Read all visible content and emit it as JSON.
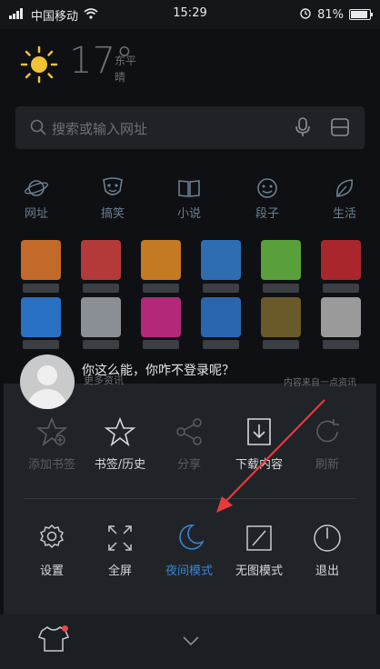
{
  "status": {
    "carrier": "中国移动",
    "time": "15:29",
    "battery": "81%"
  },
  "weather": {
    "temp": "17°",
    "city": "东平",
    "condition": "晴"
  },
  "search": {
    "placeholder": "搜索或输入网址"
  },
  "categories": [
    {
      "label": "网址",
      "icon": "planet-icon"
    },
    {
      "label": "搞笑",
      "icon": "mask-icon"
    },
    {
      "label": "小说",
      "icon": "book-icon"
    },
    {
      "label": "段子",
      "icon": "smile-icon"
    },
    {
      "label": "生活",
      "icon": "leaf-icon"
    }
  ],
  "user": {
    "greeting": "你这么能，你咋不登录呢？",
    "faded_left": "更多资讯",
    "faded_right": "内容来自一点资讯"
  },
  "menu_row1": [
    {
      "label": "添加书签",
      "icon": "star-plus-icon",
      "state": "dim"
    },
    {
      "label": "书签/历史",
      "icon": "star-icon",
      "state": "bright"
    },
    {
      "label": "分享",
      "icon": "share-icon",
      "state": "dim"
    },
    {
      "label": "下载内容",
      "icon": "download-icon",
      "state": "bright"
    },
    {
      "label": "刷新",
      "icon": "refresh-icon",
      "state": "dim"
    }
  ],
  "menu_row2": [
    {
      "label": "设置",
      "icon": "gear-icon",
      "state": "normal"
    },
    {
      "label": "全屏",
      "icon": "fullscreen-icon",
      "state": "normal"
    },
    {
      "label": "夜间模式",
      "icon": "moon-icon",
      "state": "active"
    },
    {
      "label": "无图模式",
      "icon": "no-image-icon",
      "state": "normal"
    },
    {
      "label": "退出",
      "icon": "power-icon",
      "state": "normal"
    }
  ],
  "colors": {
    "accent": "#3a84d6",
    "arrow": "#e83a3a"
  }
}
